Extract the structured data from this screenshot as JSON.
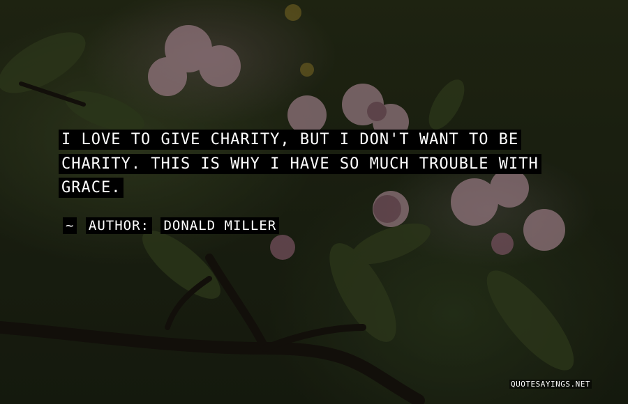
{
  "quote": {
    "text": "I LOVE TO GIVE CHARITY, BUT I DON'T WANT TO BE CHARITY. THIS IS WHY I HAVE SO MUCH TROUBLE WITH GRACE.",
    "attribution_prefix": "~",
    "attribution_label": "AUTHOR:",
    "author": "DONALD MILLER"
  },
  "watermark": "QUOTESAYINGS.NET",
  "colors": {
    "text": "#ffffff",
    "text_highlight": "#000000",
    "background_dark": "#1d2313",
    "blossom_pink": "#c9a2ad"
  },
  "background_subject": "apple-blossom-branch-icon"
}
